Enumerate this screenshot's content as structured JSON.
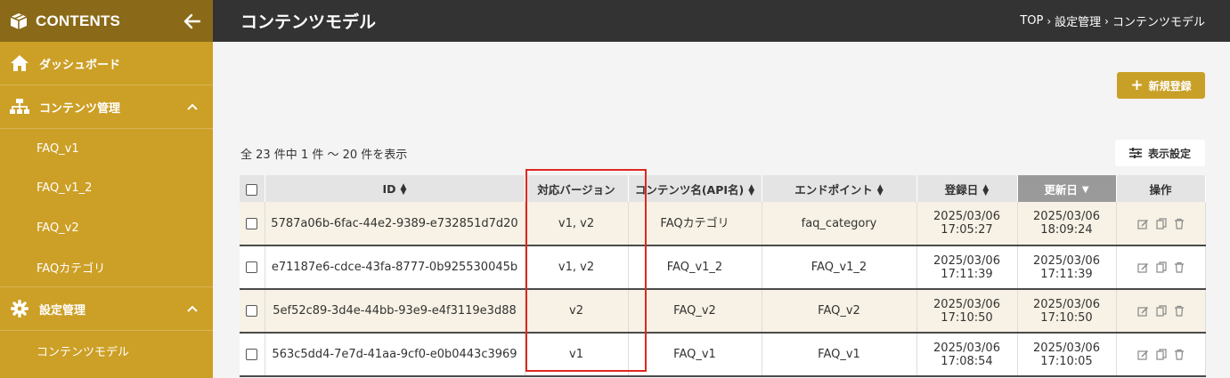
{
  "sidebar": {
    "title": "CONTENTS",
    "sections": [
      {
        "label": "ダッシュボード"
      },
      {
        "label": "コンテンツ管理",
        "items": [
          "FAQ_v1",
          "FAQ_v1_2",
          "FAQ_v2",
          "FAQカテゴリ"
        ]
      },
      {
        "label": "設定管理",
        "items": [
          "コンテンツモデル"
        ]
      }
    ]
  },
  "header": {
    "title": "コンテンツモデル",
    "breadcrumb": [
      "TOP",
      "設定管理",
      "コンテンツモデル"
    ],
    "breadcrumb_sep": "›"
  },
  "toolbar": {
    "new_button": "新規登録",
    "display_settings": "表示設定",
    "count_text": "全 23 件中 1 件 〜 20 件を表示"
  },
  "table": {
    "columns": [
      "ID",
      "対応バージョン",
      "コンテンツ名(API名)",
      "エンドポイント",
      "登録日",
      "更新日",
      "操作"
    ],
    "rows": [
      {
        "id": "5787a06b-6fac-44e2-9389-e732851d7d20",
        "version": "v1, v2",
        "name": "FAQカテゴリ",
        "endpoint": "faq_category",
        "created_date": "2025/03/06",
        "created_time": "17:05:27",
        "updated_date": "2025/03/06",
        "updated_time": "18:09:24"
      },
      {
        "id": "e71187e6-cdce-43fa-8777-0b925530045b",
        "version": "v1, v2",
        "name": "FAQ_v1_2",
        "endpoint": "FAQ_v1_2",
        "created_date": "2025/03/06",
        "created_time": "17:11:39",
        "updated_date": "2025/03/06",
        "updated_time": "17:11:39"
      },
      {
        "id": "5ef52c89-3d4e-44bb-93e9-e4f3119e3d88",
        "version": "v2",
        "name": "FAQ_v2",
        "endpoint": "FAQ_v2",
        "created_date": "2025/03/06",
        "created_time": "17:10:50",
        "updated_date": "2025/03/06",
        "updated_time": "17:10:50"
      },
      {
        "id": "563c5dd4-7e7d-41aa-9cf0-e0b0443c3969",
        "version": "v1",
        "name": "FAQ_v1",
        "endpoint": "FAQ_v1",
        "created_date": "2025/03/06",
        "created_time": "17:08:54",
        "updated_date": "2025/03/06",
        "updated_time": "17:10:05"
      }
    ]
  },
  "icons": {
    "logo": "box-icon",
    "back": "arrow-left-icon",
    "dashboard": "home-icon",
    "contents": "sitemap-icon",
    "settings": "gear-icon",
    "expand": "chevron-up-icon",
    "sort": "sort-icon",
    "sort_desc": "caret-down-icon",
    "edit": "edit-icon",
    "copy": "copy-icon",
    "delete": "trash-icon"
  },
  "colors": {
    "accent": "#cc9f26",
    "highlight": "#e0281d",
    "header": "#333333"
  }
}
